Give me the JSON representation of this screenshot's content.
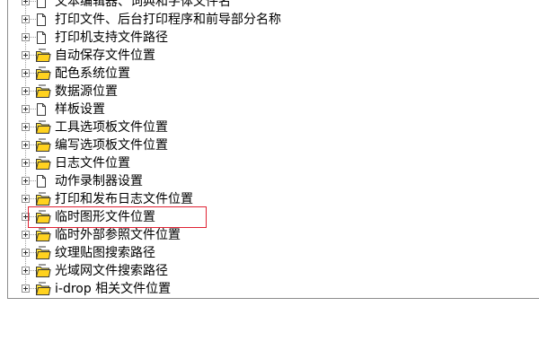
{
  "tree": {
    "items": [
      {
        "label": "文本编辑器、词典和字体文件名",
        "icon": "document-icon"
      },
      {
        "label": "打印文件、后台打印程序和前导部分名称",
        "icon": "document-icon"
      },
      {
        "label": "打印机支持文件路径",
        "icon": "document-icon"
      },
      {
        "label": "自动保存文件位置",
        "icon": "folder-icon"
      },
      {
        "label": "配色系统位置",
        "icon": "folder-icon"
      },
      {
        "label": "数据源位置",
        "icon": "folder-icon"
      },
      {
        "label": "样板设置",
        "icon": "document-icon"
      },
      {
        "label": "工具选项板文件位置",
        "icon": "folder-icon"
      },
      {
        "label": "编写选项板文件位置",
        "icon": "folder-icon"
      },
      {
        "label": "日志文件位置",
        "icon": "folder-icon"
      },
      {
        "label": "动作录制器设置",
        "icon": "document-icon"
      },
      {
        "label": "打印和发布日志文件位置",
        "icon": "folder-icon"
      },
      {
        "label": "临时图形文件位置",
        "icon": "folder-icon",
        "highlighted": true
      },
      {
        "label": "临时外部参照文件位置",
        "icon": "folder-icon"
      },
      {
        "label": "纹理贴图搜索路径",
        "icon": "folder-icon"
      },
      {
        "label": "光域网文件搜索路径",
        "icon": "folder-icon"
      },
      {
        "label": "i-drop 相关文件位置",
        "icon": "folder-icon"
      }
    ]
  },
  "colors": {
    "highlight_border": "#e02233",
    "folder_fill": "#ffe23a",
    "panel_border": "#8c8c8c"
  }
}
